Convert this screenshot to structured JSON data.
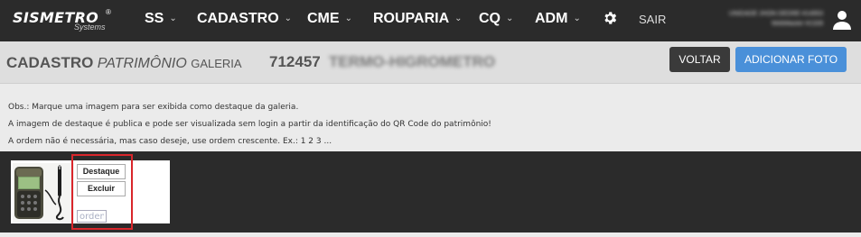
{
  "navbar": {
    "logo": {
      "name": "SISMETRO",
      "registered": "®",
      "subtitle": "Systems"
    },
    "items": [
      {
        "label": "SS"
      },
      {
        "label": "CADASTRO"
      },
      {
        "label": "CME"
      },
      {
        "label": "ROUPARIA"
      },
      {
        "label": "CQ"
      },
      {
        "label": "ADM"
      }
    ],
    "settings_icon": "gear-icon",
    "logout_label": "SAIR",
    "user": {
      "line1": "UNIDADE JHON DEDRE #14953",
      "line2": "WebMaster #1328"
    },
    "avatar_icon": "user-icon"
  },
  "header": {
    "title_bold": "CADASTRO",
    "title_italic": "PATRIMÔNIO",
    "title_small": "GALERIA",
    "asset_number": "712457",
    "asset_name": "TERMO-HIGROMETRO",
    "back_label": "VOLTAR",
    "add_photo_label": "ADICIONAR FOTO"
  },
  "notes": [
    "Obs.: Marque uma imagem para ser exibida como destaque da galeria.",
    "A imagem de destaque é publica e pode ser visualizada sem login a partir da identificação do QR Code do patrimônio!",
    "A ordem não é necessária, mas caso deseje, use ordem crescente. Ex.: 1 2 3 ..."
  ],
  "gallery": {
    "photo": {
      "highlight_label": "Destaque",
      "delete_label": "Excluir",
      "order_placeholder": "ordem",
      "order_value": ""
    }
  },
  "colors": {
    "navbar_bg": "#2b2b2b",
    "primary": "#4a90d9",
    "dark_button": "#3a3a3a",
    "highlight": "#d9262b"
  }
}
